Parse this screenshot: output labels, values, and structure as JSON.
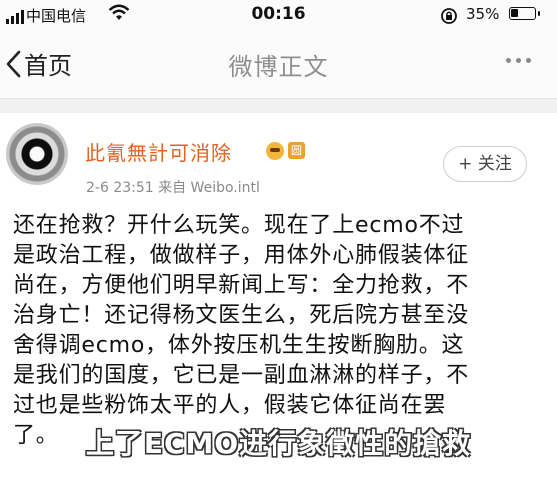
{
  "status_bar": {
    "carrier": "中国电信",
    "time": "00:16",
    "battery": "35%"
  },
  "nav": {
    "back_label": "首页",
    "title": "微博正文"
  },
  "post": {
    "username": "此氰無計可消除",
    "badge2": "圆",
    "meta": "2-6 23:51  来自 Weibo.intl",
    "follow_label": "+ 关注",
    "lines": [
      "还在抢救？开什么玩笑。现在了上ecmo不过",
      "是政治工程，做做样子，用体外心肺假装体征",
      "尚在，方便他们明早新闻上写：全力抢救，不",
      "治身亡！还记得杨文医生么，死后院方甚至没",
      "舍得调ecmo，体外按压机生生按断胸肋。这",
      "是我们的国度，它已是一副血淋淋的样子，不",
      "过也是些粉饰太平的人，假装它体征尚在罢",
      "了。"
    ]
  },
  "caption": "上了ECMO进行象徵性的搶救",
  "colors": {
    "accent": "#e0631f",
    "text": "#111111",
    "muted": "#8a8a8a"
  }
}
